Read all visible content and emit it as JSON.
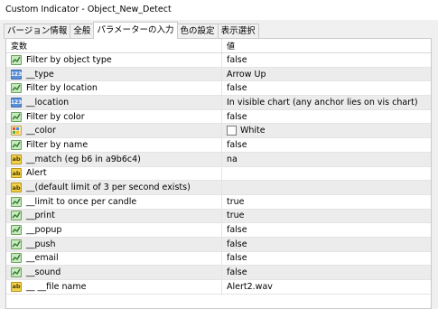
{
  "window": {
    "title": "Custom Indicator - Object_New_Detect"
  },
  "tabs": [
    {
      "label": "バージョン情報"
    },
    {
      "label": "全般"
    },
    {
      "label": "パラメーターの入力"
    },
    {
      "label": "色の設定"
    },
    {
      "label": "表示選択"
    }
  ],
  "active_tab": 2,
  "table": {
    "headers": {
      "variable": "変数",
      "value": "値"
    },
    "rows": [
      {
        "icon": "bool-icon",
        "name": "Filter by object type",
        "value": "false"
      },
      {
        "icon": "enum-icon",
        "name": "__type",
        "value": "Arrow Up"
      },
      {
        "icon": "bool-icon",
        "name": "Filter by location",
        "value": "false"
      },
      {
        "icon": "enum-icon",
        "name": "__location",
        "value": "In visible chart (any anchor lies on vis chart)"
      },
      {
        "icon": "bool-icon",
        "name": "Filter by color",
        "value": "false"
      },
      {
        "icon": "color-icon",
        "name": "__color",
        "value": "White",
        "swatch": "#ffffff"
      },
      {
        "icon": "bool-icon",
        "name": "Filter by name",
        "value": "false"
      },
      {
        "icon": "string-icon",
        "name": "__match (eg b6 in a9b6c4)",
        "value": "na"
      },
      {
        "icon": "string-icon",
        "name": "Alert",
        "value": ""
      },
      {
        "icon": "string-icon",
        "name": "__(default limit of 3 per second exists)",
        "value": ""
      },
      {
        "icon": "bool-icon",
        "name": "__limit to once per candle",
        "value": "true"
      },
      {
        "icon": "bool-icon",
        "name": "__print",
        "value": "true"
      },
      {
        "icon": "bool-icon",
        "name": "__popup",
        "value": "false"
      },
      {
        "icon": "bool-icon",
        "name": "__push",
        "value": "false"
      },
      {
        "icon": "bool-icon",
        "name": "__email",
        "value": "false"
      },
      {
        "icon": "bool-icon",
        "name": "__sound",
        "value": "false"
      },
      {
        "icon": "string-icon",
        "name": "__ __file name",
        "value": "Alert2.wav"
      }
    ]
  },
  "icon_labels": {
    "enum": "123",
    "string": "ab"
  },
  "colors": {
    "shaded_row": "#ececec",
    "bool_icon": "#c8e8c0",
    "enum_icon": "#5a8fd6",
    "string_icon": "#f2d24a"
  }
}
